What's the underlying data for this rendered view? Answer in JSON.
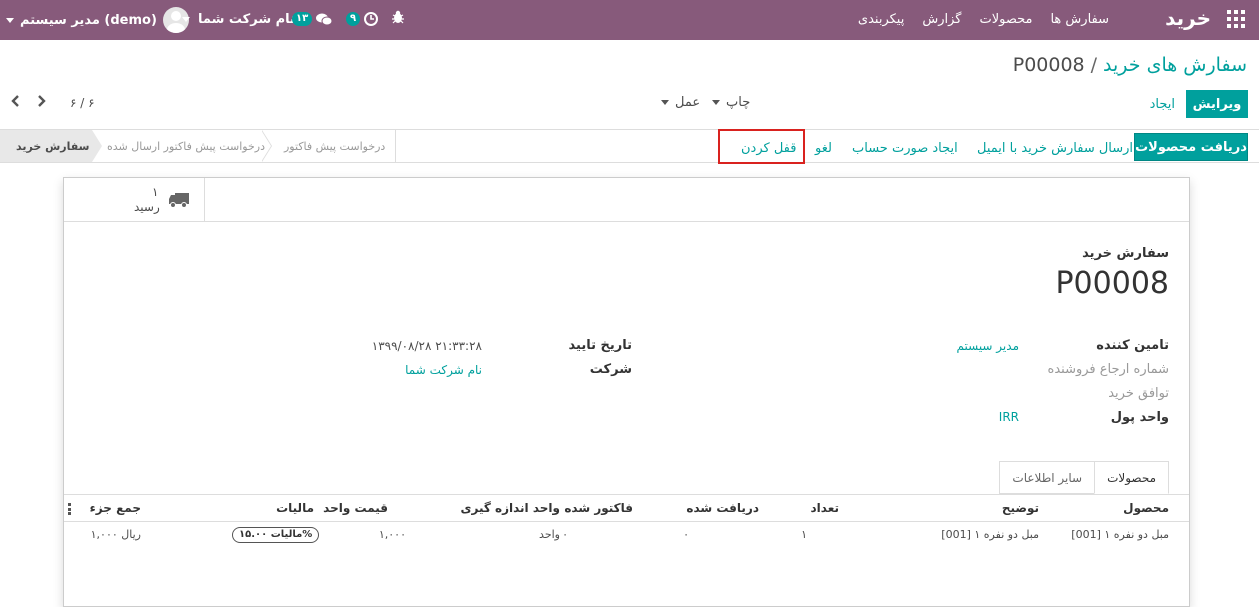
{
  "navbar": {
    "app_name": "خرید",
    "menu": [
      "سفارش ها",
      "محصولات",
      "گزارش",
      "پیکربندی"
    ],
    "user_name": "مدیر سیستم (demo)",
    "company_name": "نام شرکت شما",
    "chat_count": "۱۳",
    "activity_count": "۹",
    "color": "#875a7b"
  },
  "breadcrumb": {
    "parent": "سفارش های خرید",
    "separator": "/",
    "current": "P00008"
  },
  "controls": {
    "edit_label": "ویرایش",
    "create_label": "ایجاد",
    "print_label": "چاپ",
    "action_label": "عمل",
    "pager": "۶ / ۶"
  },
  "statusbar": {
    "receive_label": "دریافت محصولات",
    "send_email_label": "ارسال سفارش خرید با ایمیل",
    "create_bill_label": "ایجاد صورت حساب",
    "cancel_label": "لغو",
    "lock_label": "قفل کردن",
    "stages": [
      "سفارش خرید",
      "درخواست پیش فاکتور ارسال شده",
      "درخواست پیش فاکتور"
    ],
    "active_stage": "سفارش خرید"
  },
  "smart_button": {
    "count": "۱",
    "label": "رسید",
    "icon": "truck-icon"
  },
  "form": {
    "title_label": "سفارش خرید",
    "po_name": "P00008",
    "vendor_label": "تامین کننده",
    "vendor_value": "مدیر سیستم",
    "vendor_ref_label": "شماره ارجاع فروشنده",
    "agreement_label": "توافق خرید",
    "currency_label": "واحد پول",
    "currency_value": "IRR",
    "confirm_date_label": "تاریخ تایید",
    "confirm_date_value": "۱۳۹۹/۰۸/۲۸ ۲۱:۳۳:۲۸",
    "company_label": "شرکت",
    "company_value": "نام شرکت شما"
  },
  "tabs": [
    "محصولات",
    "سایر اطلاعات"
  ],
  "table": {
    "headers": {
      "product": "محصول",
      "description": "توضیح",
      "qty": "تعداد",
      "received": "دریافت شده",
      "billed": "فاکتور شده",
      "uom": "واحد اندازه گیری",
      "price": "قیمت واحد",
      "taxes": "مالیات",
      "subtotal": "جمع جزء"
    },
    "rows": [
      {
        "product": "[001] مبل دو نفره ۱",
        "description": "[001] مبل دو نفره ۱",
        "qty": "۱",
        "received": "۰",
        "billed": "۰",
        "uom": "واحد",
        "price": "۱,۰۰۰",
        "tax": "مالیات ۱۵.۰۰%",
        "subtotal": "۱,۰۰۰ ریال"
      }
    ]
  }
}
